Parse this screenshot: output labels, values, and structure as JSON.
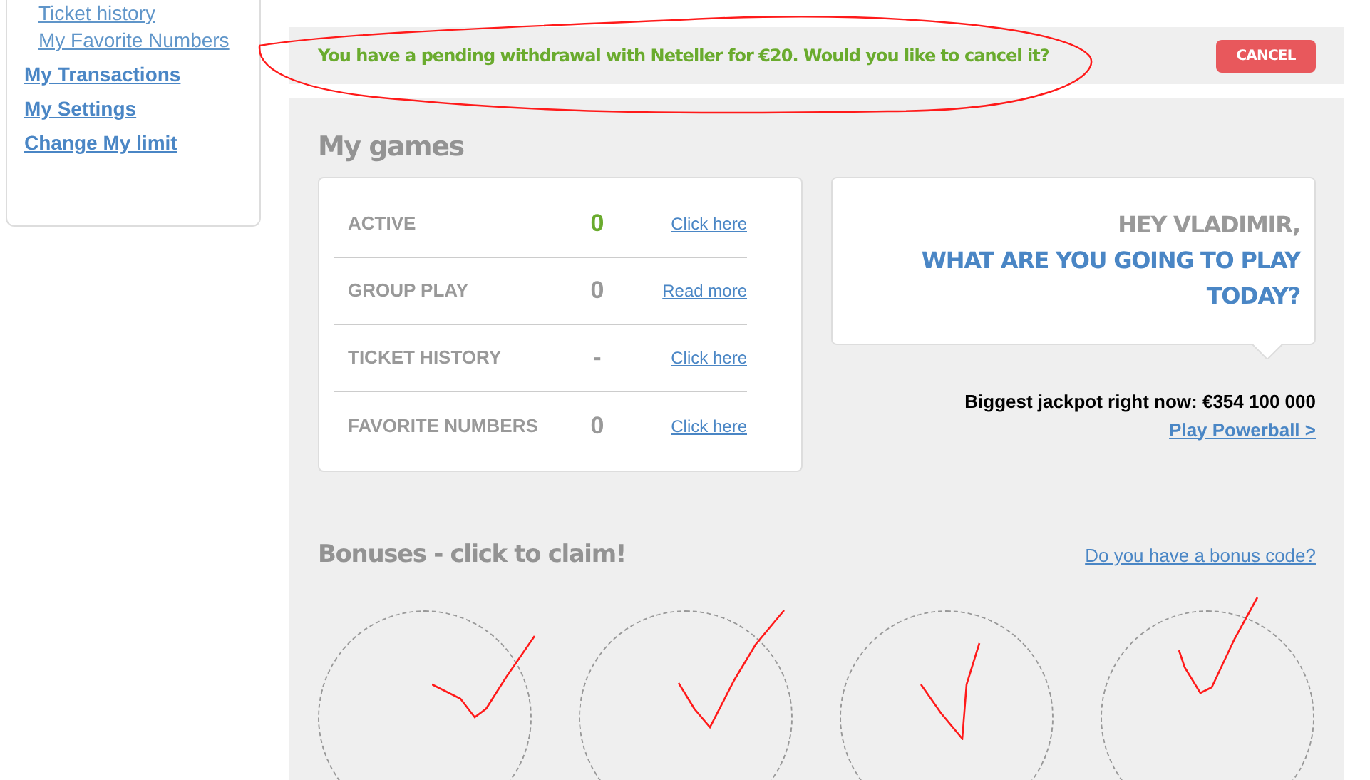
{
  "sidebar": {
    "sub_items": [
      "Ticket history",
      "My Favorite Numbers"
    ],
    "items": [
      "My Transactions",
      "My Settings",
      "Change My limit"
    ]
  },
  "banner": {
    "message": "You have a pending withdrawal with Neteller for €20. Would you like to cancel it?",
    "button": "CANCEL"
  },
  "my_games": {
    "title": "My games",
    "rows": [
      {
        "label": "ACTIVE",
        "value": "0",
        "highlight": true,
        "link": "Click here"
      },
      {
        "label": "GROUP PLAY",
        "value": "0",
        "highlight": false,
        "link": "Read more"
      },
      {
        "label": "TICKET HISTORY",
        "value": "-",
        "highlight": false,
        "link": "Click here"
      },
      {
        "label": "FAVORITE NUMBERS",
        "value": "0",
        "highlight": false,
        "link": "Click here"
      }
    ]
  },
  "greeting": {
    "line_1": "HEY VLADIMIR,",
    "line_2": "WHAT ARE YOU GOING TO PLAY TODAY?",
    "jackpot": "Biggest jackpot right now: €354 100 000",
    "link": "Play Powerball >"
  },
  "bonuses": {
    "title": "Bonuses - click to claim!",
    "code_link": "Do you have a bonus code?",
    "slots": [
      {
        "checked": true
      },
      {
        "checked": true
      },
      {
        "checked": true
      },
      {
        "checked": true
      }
    ]
  }
}
